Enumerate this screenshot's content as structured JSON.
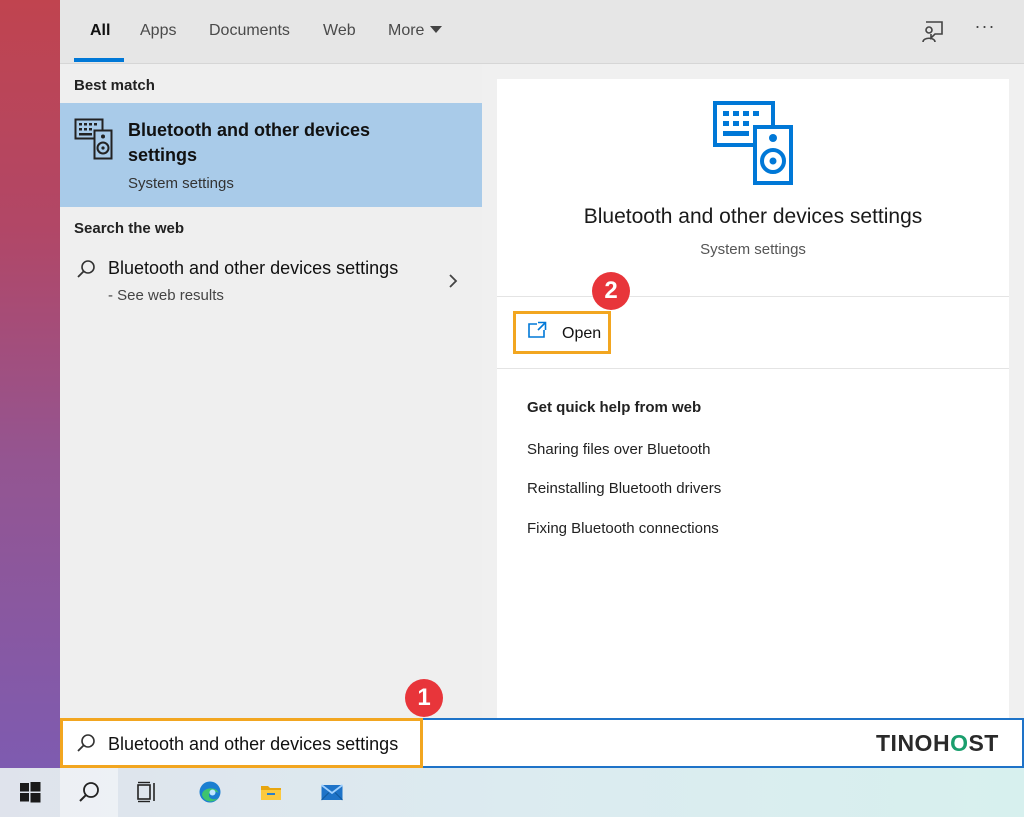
{
  "tabs": [
    {
      "label": "All",
      "active": true
    },
    {
      "label": "Apps",
      "active": false
    },
    {
      "label": "Documents",
      "active": false
    },
    {
      "label": "Web",
      "active": false
    },
    {
      "label": "More",
      "active": false
    }
  ],
  "toolbar": {
    "feedback_icon": "feedback-icon",
    "more_options_label": "···"
  },
  "results": {
    "best_match_label": "Best match",
    "best_match": {
      "title": "Bluetooth and other devices settings",
      "subtitle": "System settings",
      "icon": "devices-icon"
    },
    "search_web_label": "Search the web",
    "web_item": {
      "title": "Bluetooth and other devices settings",
      "subtitle": "- See web results",
      "icon": "search-icon"
    }
  },
  "detail": {
    "title": "Bluetooth and other devices settings",
    "subtitle": "System settings",
    "open_label": "Open",
    "quick_help_title": "Get quick help from web",
    "help_links": [
      "Sharing files over Bluetooth",
      "Reinstalling Bluetooth drivers",
      "Fixing Bluetooth connections"
    ]
  },
  "callouts": {
    "step1": "1",
    "step2": "2"
  },
  "search": {
    "value": "Bluetooth and other devices settings"
  },
  "brand": {
    "part1": "TINO",
    "part2": "H",
    "part3": "O",
    "part4": "ST"
  },
  "taskbar": {
    "buttons": [
      "windows-start-icon",
      "search-icon",
      "task-view-icon",
      "edge-icon",
      "file-explorer-icon",
      "mail-icon"
    ]
  },
  "colors": {
    "accent": "#0078d7",
    "highlight_outline": "#f2a620",
    "callout": "#e8353a",
    "selected_row": "#a9cbe9",
    "brand_green": "#1a9e6d"
  }
}
